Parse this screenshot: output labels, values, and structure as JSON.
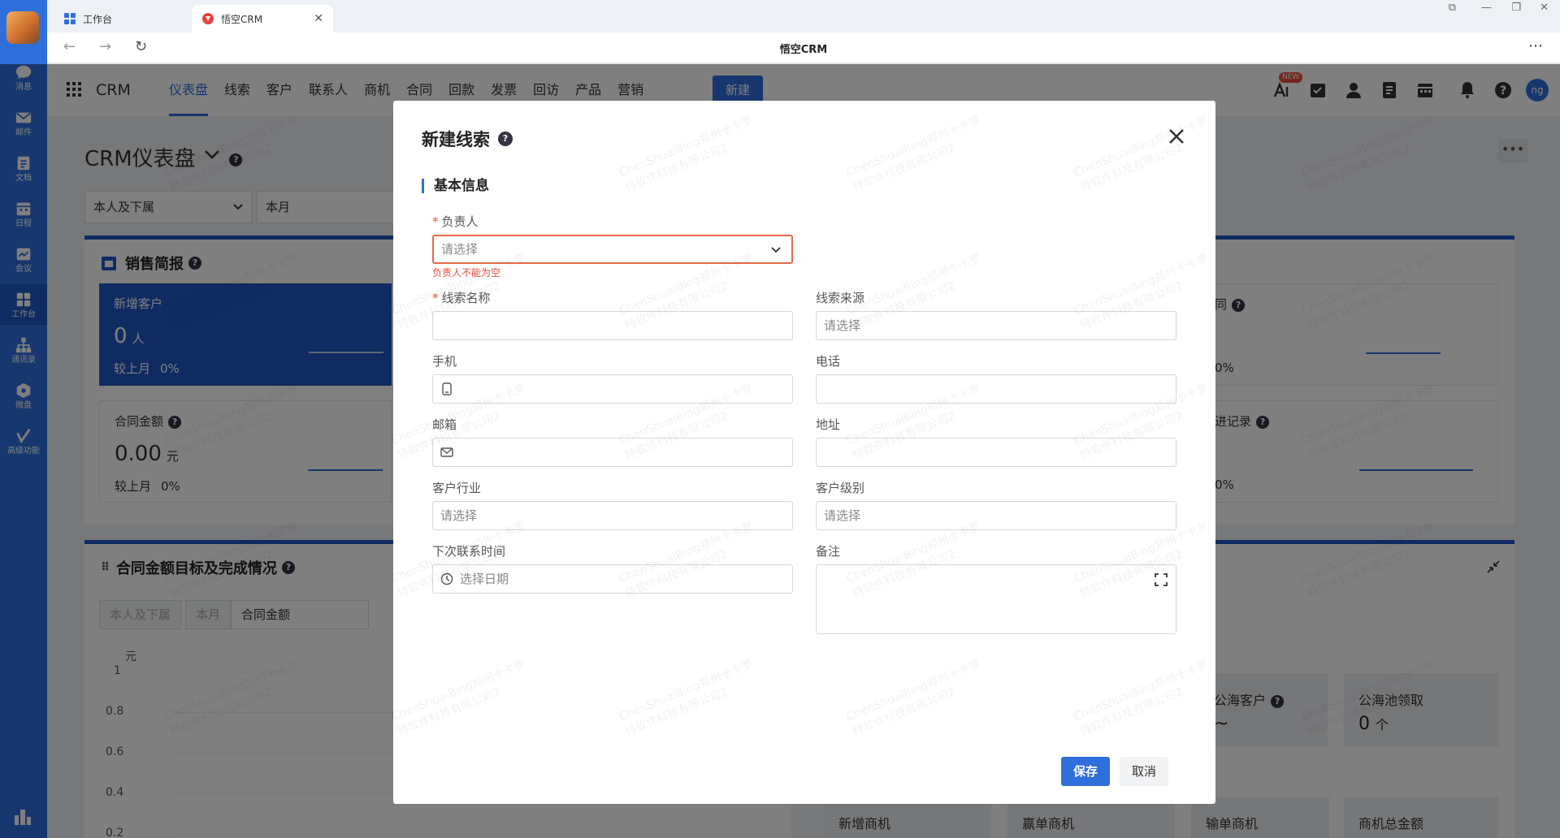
{
  "rail": {
    "items": [
      {
        "label": "消息",
        "icon": "chat-icon"
      },
      {
        "label": "邮件",
        "icon": "mail-icon"
      },
      {
        "label": "文档",
        "icon": "document-icon"
      },
      {
        "label": "日程",
        "icon": "calendar-icon"
      },
      {
        "label": "会议",
        "icon": "meeting-icon"
      },
      {
        "label": "工作台",
        "icon": "apps-icon"
      },
      {
        "label": "通讯录",
        "icon": "org-icon"
      },
      {
        "label": "微盘",
        "icon": "drive-icon"
      },
      {
        "label": "高级功能",
        "icon": "advanced-icon"
      }
    ]
  },
  "browser": {
    "tabs": [
      {
        "label": "工作台"
      },
      {
        "label": "悟空CRM"
      }
    ],
    "page_title": "悟空CRM"
  },
  "header": {
    "brand": "CRM",
    "nav": [
      "仪表盘",
      "线索",
      "客户",
      "联系人",
      "商机",
      "合同",
      "回款",
      "发票",
      "回访",
      "产品",
      "营销"
    ],
    "new_button": "新建",
    "new_badge": "NEW",
    "avatar": "ng"
  },
  "dashboard": {
    "title": "CRM仪表盘",
    "filter_scope": "本人及下属",
    "filter_period": "本月",
    "sales_brief": {
      "title": "销售简报",
      "cards": [
        {
          "label": "新增客户",
          "value": "0",
          "unit": "人",
          "compare_label": "较上月",
          "compare_value": "0%"
        },
        {
          "label": "合同金额",
          "value": "0.00",
          "unit": "元",
          "compare_label": "较上月",
          "compare_value": "0%"
        }
      ],
      "right_cards": [
        {
          "label_tail": "同",
          "compare_value": "0%"
        },
        {
          "label_tail": "进记录",
          "compare_value": "0%"
        }
      ]
    },
    "contract_target": {
      "title": "合同金额目标及完成情况",
      "chips": [
        "本人及下属",
        "本月",
        "合同金额"
      ],
      "y_unit": "元",
      "y_ticks": [
        "1",
        "0.8",
        "0.6",
        "0.4",
        "0.2"
      ]
    },
    "pool": [
      {
        "label": "公海客户",
        "value": "~"
      },
      {
        "label": "公海池领取",
        "value": "0",
        "unit": "个"
      }
    ],
    "business_cards": [
      "新增商机",
      "赢单商机",
      "输单商机",
      "商机总金额"
    ]
  },
  "modal": {
    "title": "新建线索",
    "section": "基本信息",
    "fields": {
      "owner": {
        "label": "负责人",
        "placeholder": "请选择",
        "error": "负责人不能为空"
      },
      "lead_name": {
        "label": "线索名称",
        "value": ""
      },
      "lead_source": {
        "label": "线索来源",
        "placeholder": "请选择"
      },
      "mobile": {
        "label": "手机",
        "value": ""
      },
      "phone": {
        "label": "电话",
        "value": ""
      },
      "email": {
        "label": "邮箱",
        "value": ""
      },
      "address": {
        "label": "地址",
        "value": ""
      },
      "industry": {
        "label": "客户行业",
        "placeholder": "请选择"
      },
      "level": {
        "label": "客户级别",
        "placeholder": "请选择"
      },
      "next_contact": {
        "label": "下次联系时间",
        "placeholder": "选择日期"
      },
      "remark": {
        "label": "备注",
        "value": ""
      }
    },
    "save": "保存",
    "cancel": "取消"
  },
  "watermark": {
    "line1": "ChenShuaiBing郑州卡卡罗",
    "line2": "特软件科技有限公司2"
  },
  "colors": {
    "primary": "#2f6fdc",
    "rail": "#2f6fdc",
    "error": "#e94c3a"
  }
}
